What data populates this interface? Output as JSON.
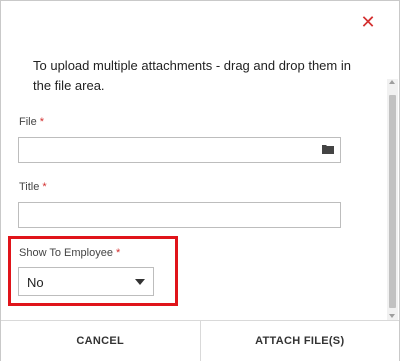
{
  "dialog": {
    "close_glyph": "✕",
    "intro_text": "To upload multiple attachments - drag and drop them in the file area.",
    "required_mark": "*"
  },
  "fields": {
    "file": {
      "label": "File",
      "value": "",
      "icon": "folder-icon"
    },
    "title": {
      "label": "Title",
      "value": ""
    },
    "show_to_employee": {
      "label": "Show To Employee",
      "selected": "No"
    }
  },
  "footer": {
    "cancel_label": "CANCEL",
    "attach_label": "ATTACH FILE(S)"
  },
  "colors": {
    "accent_red": "#d32f2f",
    "highlight_border": "#e0141a"
  }
}
